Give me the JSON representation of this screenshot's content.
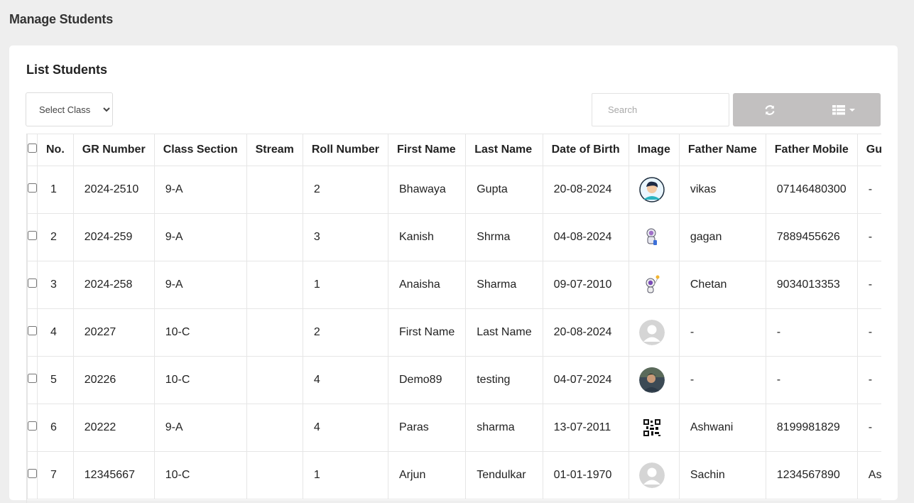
{
  "page": {
    "title": "Manage Students"
  },
  "card": {
    "title": "List Students"
  },
  "filters": {
    "class_select": {
      "selected": "Select Class"
    },
    "search": {
      "placeholder": "Search"
    }
  },
  "toolbar": {
    "refresh_icon": "refresh-icon",
    "columns_icon": "list-columns-icon"
  },
  "table": {
    "headers": [
      "No.",
      "GR Number",
      "Class Section",
      "Stream",
      "Roll Number",
      "First Name",
      "Last Name",
      "Date of Birth",
      "Image",
      "Father Name",
      "Father Mobile",
      "Gua"
    ],
    "rows": [
      {
        "no": "1",
        "gr": "2024-2510",
        "class_section": "9-A",
        "stream": "",
        "roll": "2",
        "first": "Bhawaya",
        "last": "Gupta",
        "dob": "20-08-2024",
        "image": "cartoon-boy-avatar",
        "father": "vikas",
        "father_mobile": "07146480300",
        "guardian": "-"
      },
      {
        "no": "2",
        "gr": "2024-259",
        "class_section": "9-A",
        "stream": "",
        "roll": "3",
        "first": "Kanish",
        "last": "Shrma",
        "dob": "04-08-2024",
        "image": "astronaut-avatar",
        "father": "gagan",
        "father_mobile": "7889455626",
        "guardian": "-"
      },
      {
        "no": "3",
        "gr": "2024-258",
        "class_section": "9-A",
        "stream": "",
        "roll": "1",
        "first": "Anaisha",
        "last": "Sharma",
        "dob": "09-07-2010",
        "image": "astronaut-balloon-avatar",
        "father": "Chetan",
        "father_mobile": "9034013353",
        "guardian": "-"
      },
      {
        "no": "4",
        "gr": "20227",
        "class_section": "10-C",
        "stream": "",
        "roll": "2",
        "first": "First Name",
        "last": "Last Name",
        "dob": "20-08-2024",
        "image": "placeholder-avatar",
        "father": "-",
        "father_mobile": "-",
        "guardian": "-"
      },
      {
        "no": "5",
        "gr": "20226",
        "class_section": "10-C",
        "stream": "",
        "roll": "4",
        "first": "Demo89",
        "last": "testing",
        "dob": "04-07-2024",
        "image": "person-photo-avatar",
        "father": "-",
        "father_mobile": "-",
        "guardian": "-"
      },
      {
        "no": "6",
        "gr": "20222",
        "class_section": "9-A",
        "stream": "",
        "roll": "4",
        "first": "Paras",
        "last": "sharma",
        "dob": "13-07-2011",
        "image": "qr-code-avatar",
        "father": "Ashwani",
        "father_mobile": "8199981829",
        "guardian": "-"
      },
      {
        "no": "7",
        "gr": "12345667",
        "class_section": "10-C",
        "stream": "",
        "roll": "1",
        "first": "Arjun",
        "last": "Tendulkar",
        "dob": "01-01-1970",
        "image": "placeholder-avatar",
        "father": "Sachin",
        "father_mobile": "1234567890",
        "guardian": "Ash"
      }
    ]
  }
}
